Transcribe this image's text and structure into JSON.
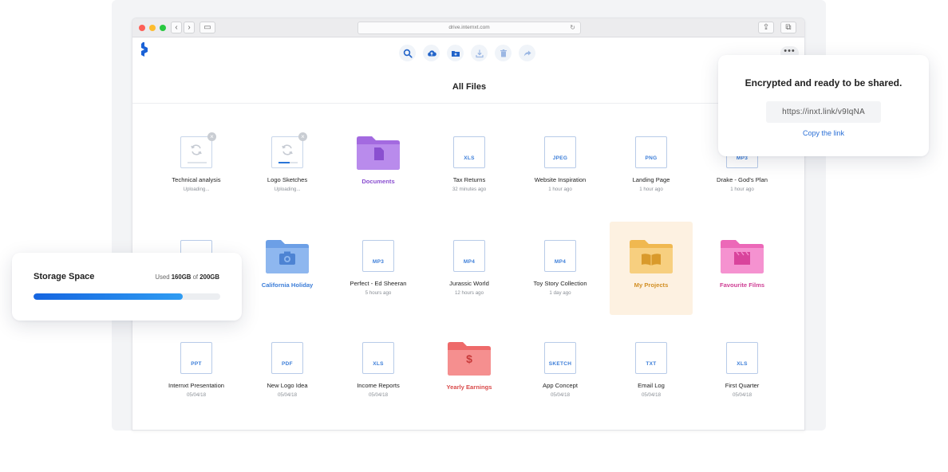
{
  "browser": {
    "url": "drive.internxt.com"
  },
  "page": {
    "title": "All Files"
  },
  "toolbar": {
    "icons": [
      "search-icon",
      "upload-cloud-icon",
      "new-folder-icon",
      "download-icon",
      "trash-icon",
      "share-icon"
    ]
  },
  "share_card": {
    "title": "Encrypted and ready to be shared.",
    "link": "https://inxt.link/v9IqNA",
    "copy_label": "Copy the link"
  },
  "storage": {
    "title": "Storage Space",
    "used_prefix": "Used",
    "used": "160GB",
    "of_label": "of",
    "total": "200GB",
    "fraction": 0.8
  },
  "files": {
    "row1": [
      {
        "name": "Technical analysis",
        "meta": "Uploading...",
        "kind": "uploading",
        "progress": 0.0
      },
      {
        "name": "Logo Sketches",
        "meta": "Uploading...",
        "kind": "uploading",
        "progress": 0.6
      },
      {
        "name": "Documents",
        "meta": "",
        "kind": "folder",
        "color": "#a36ae0"
      },
      {
        "name": "Tax Returns",
        "meta": "32 minutes ago",
        "kind": "file",
        "ext": "XLS"
      },
      {
        "name": "Website Inspiration",
        "meta": "1 hour ago",
        "kind": "file",
        "ext": "JPEG"
      },
      {
        "name": "Landing Page",
        "meta": "1 hour ago",
        "kind": "file",
        "ext": "PNG"
      },
      {
        "name": "Drake - God's Plan",
        "meta": "1 hour ago",
        "kind": "file",
        "ext": "MP3"
      }
    ],
    "row2": [
      {
        "name": "California Holiday",
        "meta": "",
        "kind": "folder",
        "color": "#6c9fe6"
      },
      {
        "name": "Perfect - Ed Sheeran",
        "meta": "5 hours ago",
        "kind": "file",
        "ext": "MP3"
      },
      {
        "name": "Jurassic World",
        "meta": "12 hours ago",
        "kind": "file",
        "ext": "MP4"
      },
      {
        "name": "Toy Story Collection",
        "meta": "1 day ago",
        "kind": "file",
        "ext": "MP4"
      },
      {
        "name": "My Projects",
        "meta": "",
        "kind": "folder",
        "color": "#f3c36b"
      },
      {
        "name": "Favourite Films",
        "meta": "",
        "kind": "folder",
        "color": "#f07fc4"
      }
    ],
    "row3": [
      {
        "name": "Internxt Presentation",
        "meta": "05/04/18",
        "kind": "file",
        "ext": "PPT"
      },
      {
        "name": "New Logo Idea",
        "meta": "05/04/18",
        "kind": "file",
        "ext": "PDF"
      },
      {
        "name": "Income Reports",
        "meta": "05/04/18",
        "kind": "file",
        "ext": "XLS"
      },
      {
        "name": "Yearly Earnings",
        "meta": "",
        "kind": "folder",
        "color": "#f07474"
      },
      {
        "name": "App Concept",
        "meta": "05/04/18",
        "kind": "file",
        "ext": "SKETCH"
      },
      {
        "name": "Email Log",
        "meta": "05/04/18",
        "kind": "file",
        "ext": "TXT"
      },
      {
        "name": "First Quarter",
        "meta": "05/04/18",
        "kind": "file",
        "ext": "XLS"
      }
    ]
  },
  "colors": {
    "accent": "#2a6fd6",
    "folder_purple": "#a36ae0",
    "folder_blue": "#6c9fe6",
    "folder_orange": "#f3c36b",
    "folder_pink": "#f07fc4",
    "folder_red": "#f07474",
    "selected_bg": "#fdf1e1"
  }
}
